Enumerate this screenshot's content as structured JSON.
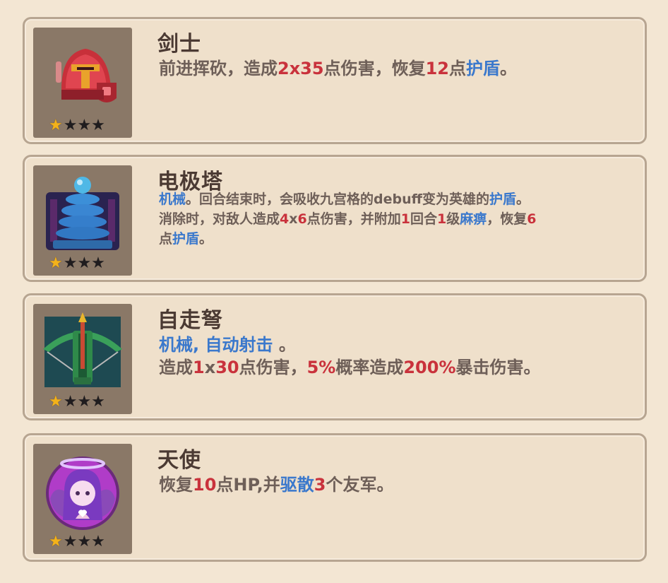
{
  "cards": [
    {
      "name": "剑士",
      "stars": "★",
      "stars_dark": "★★★",
      "desc": {
        "p1": "前进挥砍，造成",
        "v1": "2x35",
        "p2": "点伤害，恢复",
        "v2": "12",
        "p3": "点",
        "k1": "护盾",
        "p4": "。"
      }
    },
    {
      "name": "电极塔",
      "stars": "★",
      "stars_dark": "★★★",
      "desc": {
        "k1": "机械",
        "p1": "。回合结束时，会吸收九宫格的debuff变为英雄的",
        "k2": "护盾",
        "p2": "。",
        "p3": "消除时，对敌人造成",
        "v1": "4",
        "p4": "x",
        "v2": "6",
        "p5": "点伤害，并附加",
        "v3": "1",
        "p6": "回合",
        "v4": "1",
        "p7": "级",
        "k3": "麻痹",
        "p8": "，恢复",
        "v5": "6",
        "p9": "点",
        "k4": "护盾",
        "p10": "。"
      }
    },
    {
      "name": "自走弩",
      "stars": "★",
      "stars_dark": "★★★",
      "desc": {
        "k1": "机械",
        "p1": ", ",
        "k2": "自动射击",
        "p2": " 。",
        "p3": "造成",
        "v1": "1",
        "p4": "x",
        "v2": "30",
        "p5": "点伤害，",
        "v3": "5%",
        "p6": "概率造成",
        "v4": "200%",
        "p7": "暴击伤害。"
      }
    },
    {
      "name": "天使",
      "stars": "★",
      "stars_dark": "★★★",
      "desc": {
        "p1": "恢复",
        "v1": "10",
        "p2": "点HP,并",
        "k1": "驱散",
        "v2": "3",
        "p3": "个友军。"
      }
    }
  ],
  "icons": [
    "knight-helmet-icon",
    "tesla-coil-icon",
    "auto-crossbow-icon",
    "angel-icon"
  ],
  "colors": {
    "highlight_red": "#c9323c",
    "highlight_blue": "#3a78cc",
    "text": "#6e5f58"
  }
}
